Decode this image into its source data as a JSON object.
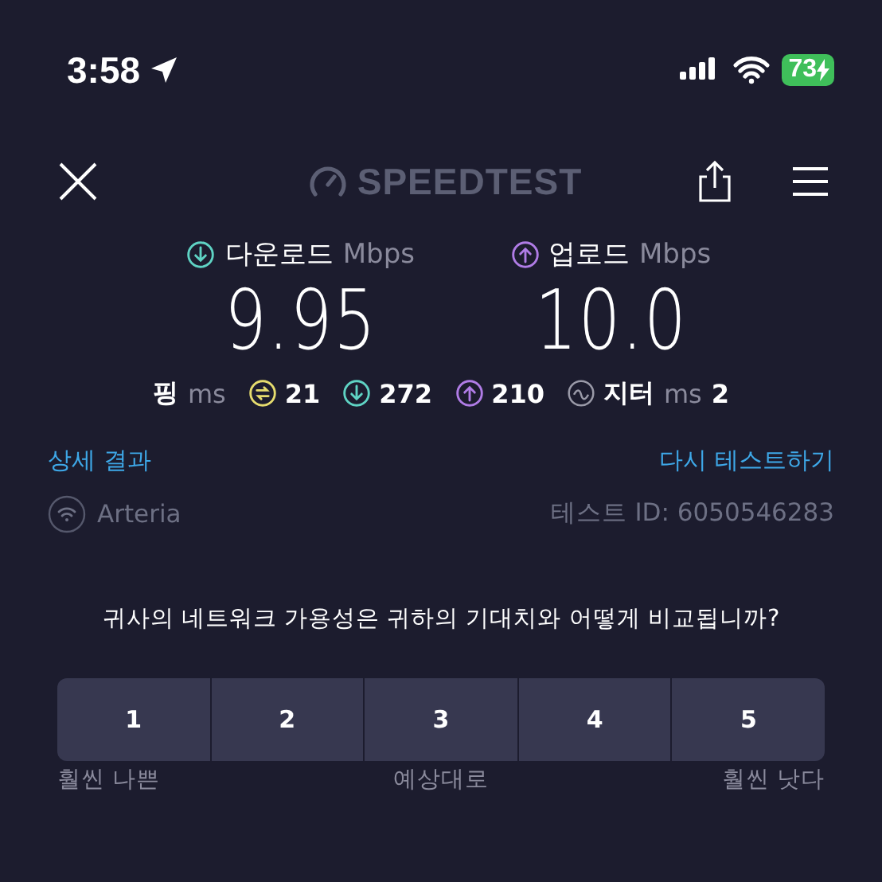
{
  "status_bar": {
    "time": "3:58",
    "battery": "73"
  },
  "header": {
    "logo": "SPEEDTEST"
  },
  "results": [
    {
      "kind": "download",
      "label": "다운로드",
      "unit": "Mbps",
      "value": "9.95"
    },
    {
      "kind": "upload",
      "label": "업로드",
      "unit": "Mbps",
      "value": "10.0"
    }
  ],
  "latency": {
    "ping_label": "핑",
    "ping_unit": "ms",
    "items": [
      {
        "kind": "idle",
        "value": "21"
      },
      {
        "kind": "download",
        "value": "272"
      },
      {
        "kind": "upload",
        "value": "210"
      }
    ],
    "jitter_label": "지터",
    "jitter_unit": "ms",
    "jitter_value": "2"
  },
  "links": {
    "details": "상세 결과",
    "retest": "다시 테스트하기"
  },
  "connection": {
    "isp": "Arteria",
    "test_id": "테스트 ID: 6050546283"
  },
  "survey": {
    "question": "귀사의 네트워크 가용성은 귀하의 기대치와 어떻게 비교됩니까?",
    "options": [
      "1",
      "2",
      "3",
      "4",
      "5"
    ],
    "scale_labels": [
      "훨씬 나쁜",
      "예상대로",
      "훨씬 낫다"
    ]
  }
}
